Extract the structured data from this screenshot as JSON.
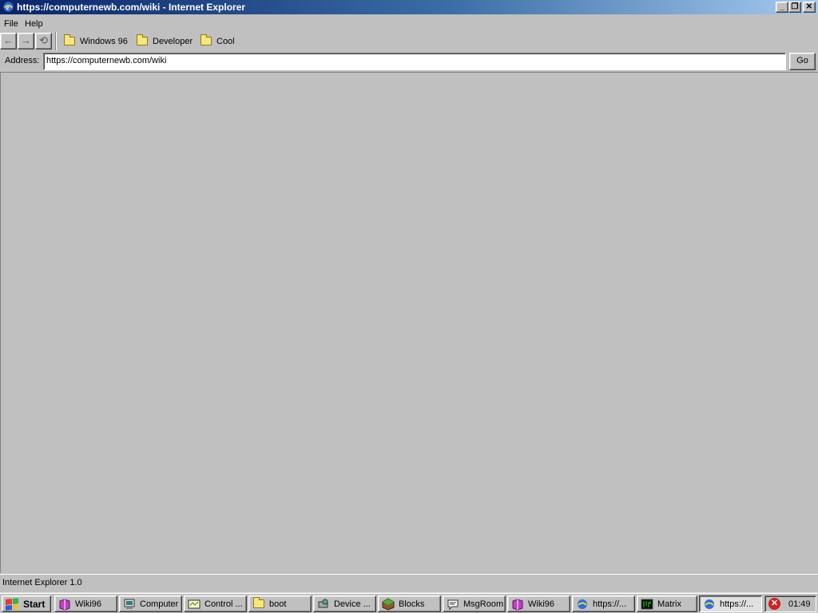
{
  "window": {
    "title": "https://computernewb.com/wiki - Internet Explorer",
    "controls": {
      "minimize": "_",
      "restore": "❐",
      "close": "✕"
    }
  },
  "menu": {
    "items": [
      "File",
      "Help"
    ]
  },
  "toolbar": {
    "back_icon": "←",
    "forward_icon": "→",
    "refresh_icon": "⟲",
    "favorites": [
      "Windows 96",
      "Developer",
      "Cool"
    ]
  },
  "address": {
    "label": "Address:",
    "value": "https://computernewb.com/wiki",
    "go_label": "Go"
  },
  "status": {
    "text": "Internet Explorer 1.0"
  },
  "taskbar": {
    "start_label": "Start",
    "tasks": [
      {
        "label": "Wiki96",
        "icon": "book-icon"
      },
      {
        "label": "Computer",
        "icon": "computer-icon"
      },
      {
        "label": "Control ...",
        "icon": "control-panel-icon"
      },
      {
        "label": "boot",
        "icon": "folder-icon"
      },
      {
        "label": "Device ...",
        "icon": "device-manager-icon"
      },
      {
        "label": "Blocks",
        "icon": "blocks-icon"
      },
      {
        "label": "MsgRoom",
        "icon": "chat-icon"
      },
      {
        "label": "Wiki96",
        "icon": "book-icon"
      },
      {
        "label": "https://...",
        "icon": "ie-icon"
      },
      {
        "label": "Matrix",
        "icon": "matrix-icon"
      },
      {
        "label": "https://...",
        "icon": "ie-icon",
        "active": true
      }
    ],
    "clock": "01:49",
    "colors": {
      "title_start": "#0a246a",
      "title_end": "#a6caf0",
      "error": "#d21f1f"
    }
  }
}
